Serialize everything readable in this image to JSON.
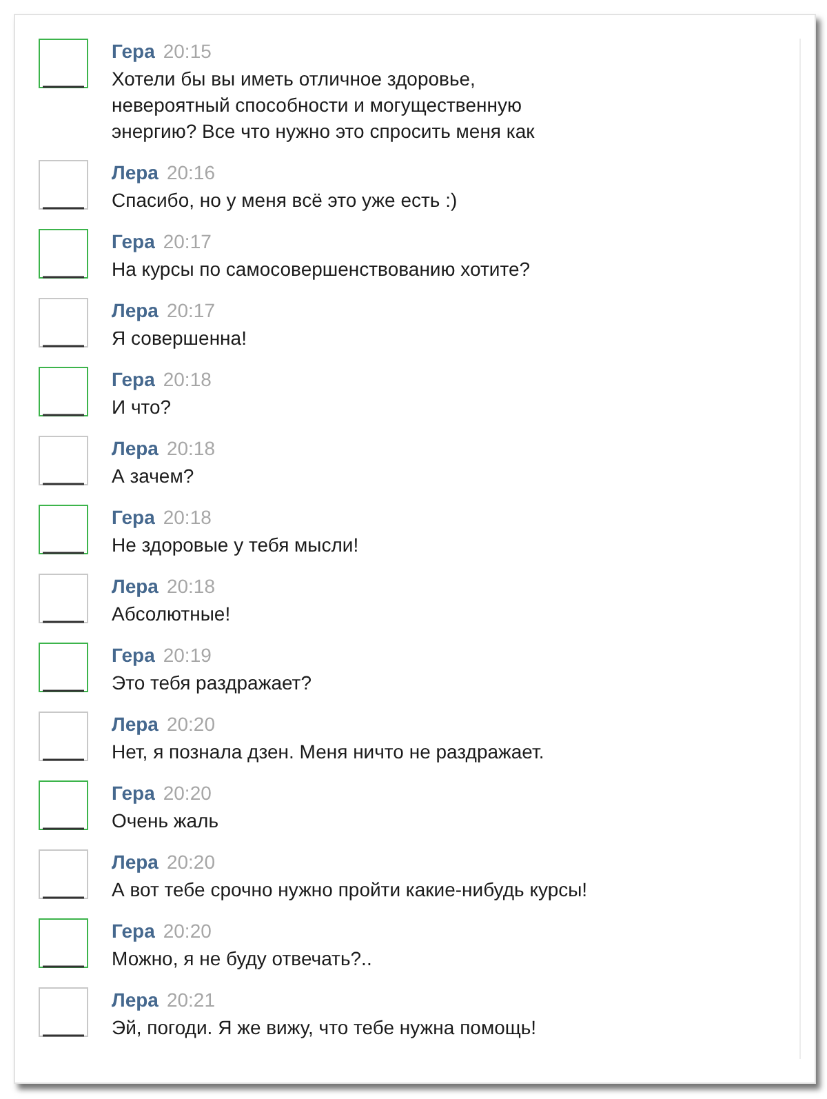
{
  "messages": [
    {
      "author": "Гера",
      "time": "20:15",
      "text": "Хотели бы вы иметь отличное здоровье,\nневероятный способности и могущественную\nэнергию? Все что нужно это спросить меня как",
      "color": "#3cb44b"
    },
    {
      "author": "Лера",
      "time": "20:16",
      "text": "Спасибо, но у меня всё это уже есть :)",
      "color": "#c8c8c8"
    },
    {
      "author": "Гера",
      "time": "20:17",
      "text": "На курсы по самосовершенствованию хотите?",
      "color": "#3cb44b"
    },
    {
      "author": "Лера",
      "time": "20:17",
      "text": "Я совершенна!",
      "color": "#c8c8c8"
    },
    {
      "author": "Гера",
      "time": "20:18",
      "text": "И что?",
      "color": "#3cb44b"
    },
    {
      "author": "Лера",
      "time": "20:18",
      "text": "А зачем?",
      "color": "#c8c8c8"
    },
    {
      "author": "Гера",
      "time": "20:18",
      "text": "Не здоровые у тебя мысли!",
      "color": "#3cb44b"
    },
    {
      "author": "Лера",
      "time": "20:18",
      "text": "Абсолютные!",
      "color": "#c8c8c8"
    },
    {
      "author": "Гера",
      "time": "20:19",
      "text": "Это тебя раздражает?",
      "color": "#3cb44b"
    },
    {
      "author": "Лера",
      "time": "20:20",
      "text": "Нет, я познала дзен. Меня ничто не раздражает.",
      "color": "#c8c8c8"
    },
    {
      "author": "Гера",
      "time": "20:20",
      "text": "Очень жаль",
      "color": "#3cb44b"
    },
    {
      "author": "Лера",
      "time": "20:20",
      "text": "А вот тебе срочно нужно пройти какие-нибудь курсы!",
      "color": "#c8c8c8"
    },
    {
      "author": "Гера",
      "time": "20:20",
      "text": "Можно, я не буду отвечать?..",
      "color": "#3cb44b"
    },
    {
      "author": "Лера",
      "time": "20:21",
      "text": "Эй, погоди. Я же вижу, что тебе нужна помощь!",
      "color": "#c8c8c8"
    }
  ]
}
